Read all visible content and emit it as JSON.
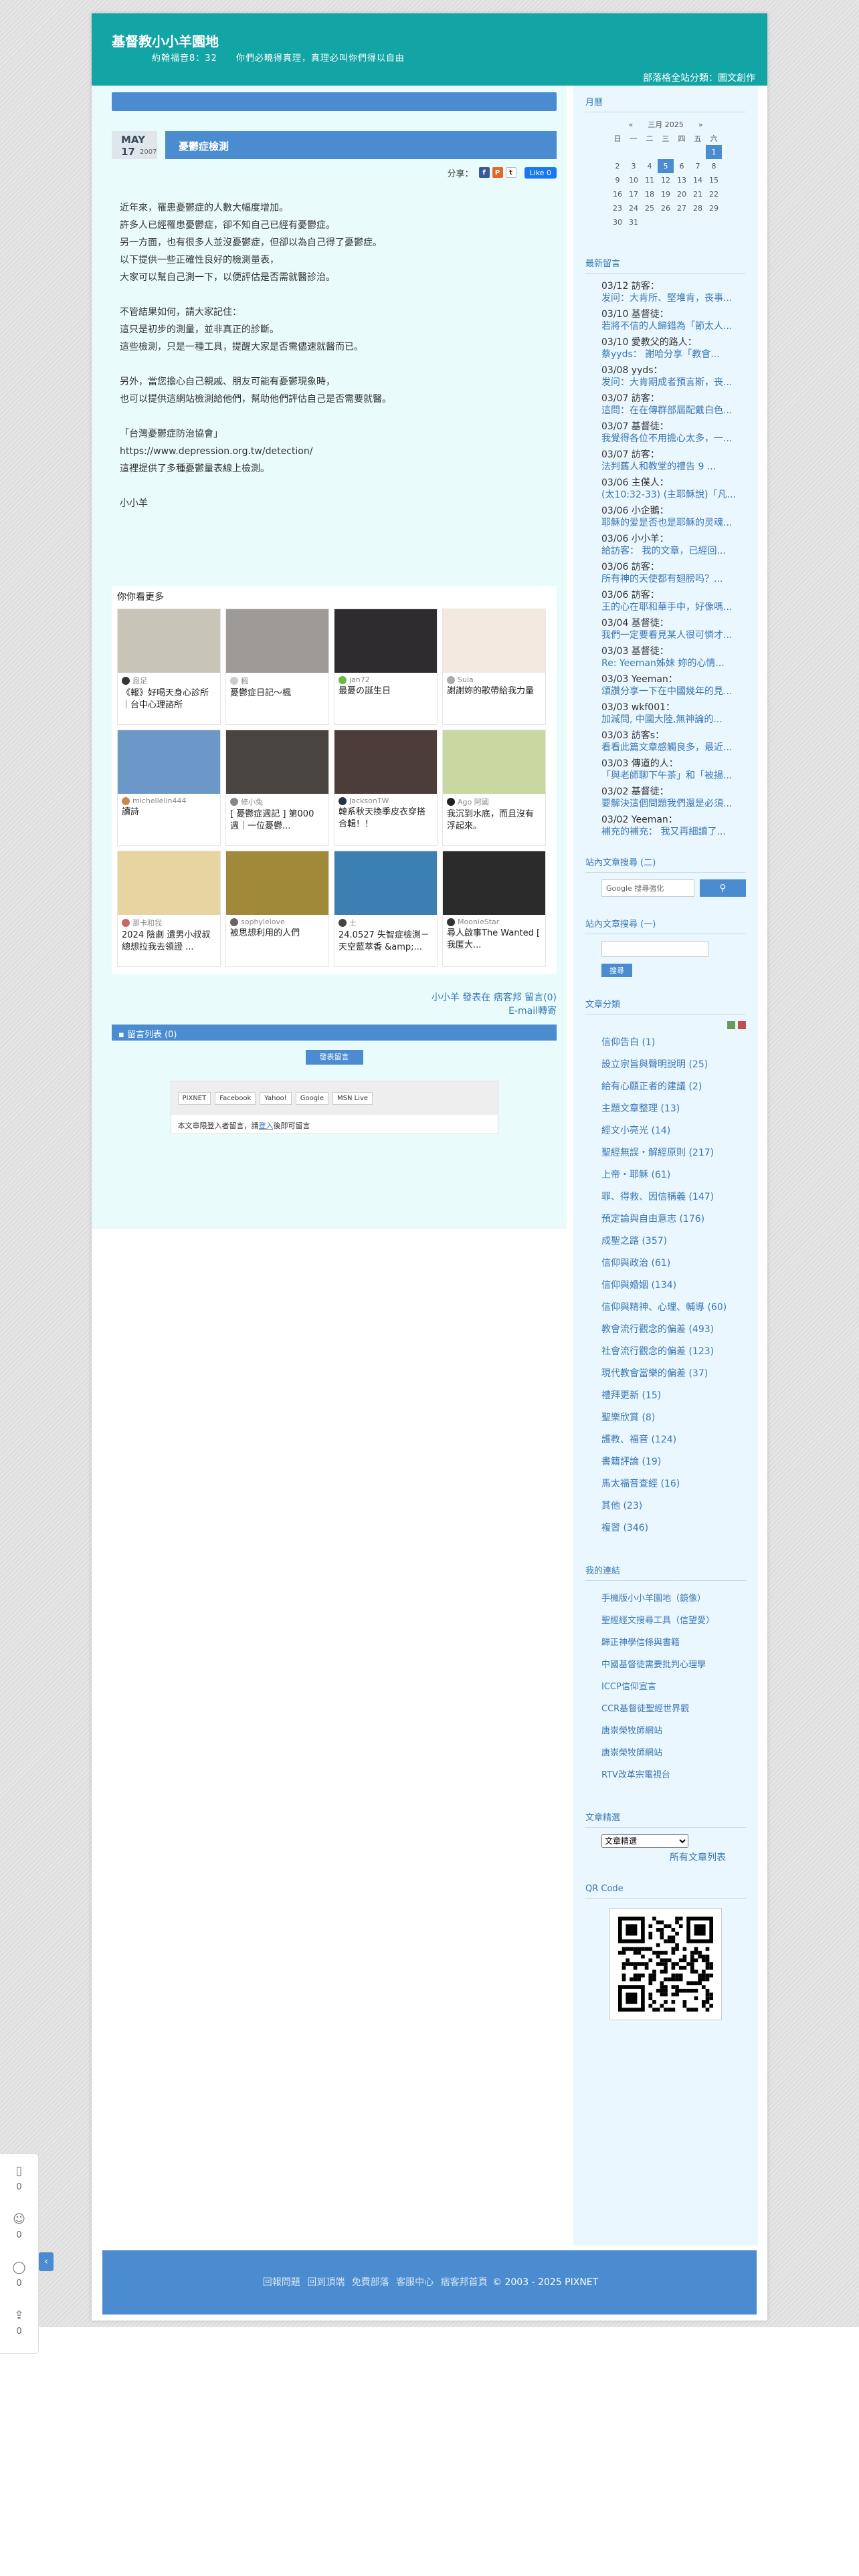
{
  "header": {
    "site_title": "基督教小小羊園地",
    "description": "約翰福音8：32　　你們必曉得真理，真理必叫你們得以自由",
    "partner_link": "部落格全站分類：圖文創作"
  },
  "post": {
    "month": "MAY",
    "day": "17",
    "year": "2007",
    "title": "憂鬱症檢測",
    "share_label": "分享：",
    "like_label": "Like 0",
    "paragraphs": [
      [
        "近年來，罹患憂鬱症的人數大幅度增加。",
        "許多人已經罹患憂鬱症，卻不知自己已經有憂鬱症。",
        "另一方面，也有很多人並沒憂鬱症，但卻以為自己得了憂鬱症。",
        "以下提供一些正確性良好的檢測量表，",
        "大家可以幫自己測一下，以便評估是否需就醫診治。"
      ],
      [
        "不管結果如何，請大家記住：",
        "這只是初步的測量，並非真正的診斷。",
        "這些檢測，只是一種工具，提醒大家是否需儘速就醫而已。"
      ],
      [
        "另外，當您擔心自己親戚、朋友可能有憂鬱現象時，",
        "也可以提供這網站檢測給他們，幫助他們評估自己是否需要就醫。"
      ],
      [
        "「台灣憂鬱症防治協會」",
        "https://www.depression.org.tw/detection/",
        "這裡提供了多種憂鬱量表線上檢測。"
      ],
      [
        "小小羊"
      ]
    ],
    "footer_line1": "小小羊 發表在 痞客邦 留言(0)",
    "footer_line2": "E-mail轉寄"
  },
  "more": {
    "title": "你你看更多",
    "cards": [
      {
        "author": "恩足",
        "title": "《報》好喝天身心診所｜台中心理諮所",
        "color": "#c9c4b8",
        "avatar": "#333"
      },
      {
        "author": "楓",
        "title": "憂鬱症日記～楓",
        "color": "#9e9a96",
        "avatar": "#ccc"
      },
      {
        "author": "jan72",
        "title": "最憂の誕生日",
        "color": "#2e2c2e",
        "avatar": "#6b4"
      },
      {
        "author": "Sula",
        "title": "謝謝妳的歌帶給我力量",
        "color": "#f3e9e1",
        "avatar": "#aaa"
      },
      {
        "author": "michellelin444",
        "title": "讀詩",
        "color": "#6b98c7",
        "avatar": "#c84"
      },
      {
        "author": "修小兔",
        "title": "[ 憂鬱症週記 ] 第000 週｜一位憂鬱...",
        "color": "#4a4440",
        "avatar": "#888"
      },
      {
        "author": "JacksonTW",
        "title": "韓系秋天換季皮衣穿搭合輯！！",
        "color": "#4c3d3a",
        "avatar": "#234"
      },
      {
        "author": "Ago 阿國",
        "title": "我沉到水底，而且沒有浮起來。",
        "color": "#c9d7a0",
        "avatar": "#222"
      },
      {
        "author": "那卡和我",
        "title": "2024 陰劇 遺男小叔叔總想拉我去領證 ...",
        "color": "#e6d5a0",
        "avatar": "#c66"
      },
      {
        "author": "sophylelove",
        "title": "被思想利用的人們",
        "color": "#a08a3a",
        "avatar": "#666"
      },
      {
        "author": "土",
        "title": "24.0527 失智症檢測－天空藍萃香 &amp;...",
        "color": "#3b7fb3",
        "avatar": "#444"
      },
      {
        "author": "MoonieStar",
        "title": "尋人啟事The Wanted [ 我匿大...",
        "color": "#2b2b2b",
        "avatar": "#333"
      }
    ]
  },
  "comments": {
    "bar_label": "留言列表 (0)",
    "post_button": "發表留言",
    "login_buttons": [
      "PIXNET",
      "Facebook",
      "Yahoo!",
      "Google",
      "MSN Live"
    ],
    "login_note_pre": "本文章限登入者留言，請",
    "login_note_link": "登入",
    "login_note_post": "後即可留言"
  },
  "sidebar": {
    "month_title": "月曆",
    "calendar": {
      "header": "«　　三月 2025　　»",
      "weekdays": [
        "日",
        "一",
        "二",
        "三",
        "四",
        "五",
        "六"
      ],
      "rows": [
        [
          "",
          "",
          "",
          "",
          "",
          "",
          "1"
        ],
        [
          "2",
          "3",
          "4",
          "5",
          "6",
          "7",
          "8"
        ],
        [
          "9",
          "10",
          "11",
          "12",
          "13",
          "14",
          "15"
        ],
        [
          "16",
          "17",
          "18",
          "19",
          "20",
          "21",
          "22"
        ],
        [
          "23",
          "24",
          "25",
          "26",
          "27",
          "28",
          "29"
        ],
        [
          "30",
          "31",
          "",
          "",
          "",
          "",
          ""
        ]
      ]
    },
    "recent_title": "最新留言",
    "recent_messages": [
      {
        "head": "03/12 訪客：",
        "body": "发问：大肯所、堅堆肯，丧事..."
      },
      {
        "head": "03/10 基督徒：",
        "body": "若將不信的人歸錯為「節太人..."
      },
      {
        "head": "03/10 愛教父的路人：",
        "body": "蔡yyds： 謝哈分享「教會..."
      },
      {
        "head": "03/08 yyds：",
        "body": "发问：大肯期成者預言斯，丧..."
      },
      {
        "head": "03/07 訪客：",
        "body": "這問：在在傳群部屆配戴白色..."
      },
      {
        "head": "03/07 基督徒：",
        "body": "我覺得各位不用擔心太多，一..."
      },
      {
        "head": "03/07 訪客：",
        "body": "法判舊人和教堂的禮告 9 ..."
      },
      {
        "head": "03/06 主僕人：",
        "body": "(太10:32-33) (主耶穌說)「凡..."
      },
      {
        "head": "03/06 小企鵝：",
        "body": "耶穌的爱是否也是耶穌的灵魂..."
      },
      {
        "head": "03/06 小小羊：",
        "body": "給訪客： 我的文章，已經回..."
      },
      {
        "head": "03/06 訪客：",
        "body": "所有神的天使都有翅膀吗？..."
      },
      {
        "head": "03/06 訪客：",
        "body": "王的心在耶和華手中，好像嗎..."
      },
      {
        "head": "03/04 基督徒：",
        "body": "我們一定要看見某人很可憐才..."
      },
      {
        "head": "03/03 基督徒：",
        "body": "Re: Yeeman姊妹 妳的心情..."
      },
      {
        "head": "03/03 Yeeman：",
        "body": "頌讚分享一下在中國幾年的見..."
      },
      {
        "head": "03/03 wkf001：",
        "body": "加減問, 中國大陸,無神論的..."
      },
      {
        "head": "03/03 訪客s：",
        "body": "看看此篇文章感觸良多，最近..."
      },
      {
        "head": "03/03 傳道的人：",
        "body": "「與老師聊下午茶」和「被揚..."
      },
      {
        "head": "03/02 基督徒：",
        "body": "要解決這個問題我們還是必須..."
      },
      {
        "head": "03/02 Yeeman：",
        "body": "補充的補充： 我又再細讀了..."
      }
    ],
    "google_title": "站內文章搜尋 (二)",
    "google_placeholder": "Google 搜尋強化",
    "site_search_title": "站內文章搜尋 (一)",
    "site_search_button": "搜尋",
    "category_title": "文章分類",
    "categories": [
      "信仰告白 (1)",
      "設立宗旨與聲明說明 (25)",
      "給有心願正者的建議 (2)",
      "主題文章整理 (13)",
      "經文小亮光 (14)",
      "聖經無誤・解經原則 (217)",
      "上帝・耶穌 (61)",
      "罪、得救、因信稱義 (147)",
      "預定論與自由意志 (176)",
      "成聖之路 (357)",
      "信仰與政治 (61)",
      "信仰與婚姻 (134)",
      "信仰與精神、心理、輔導 (60)",
      "教會流行觀念的偏差 (493)",
      "社會流行觀念的偏差 (123)",
      "現代教會當樂的偏差 (37)",
      "禮拜更新 (15)",
      "聖樂欣賞 (8)",
      "護教、福音 (124)",
      "書籍評論 (19)",
      "馬太福音查經 (16)",
      "其他 (23)",
      "複習 (346)"
    ],
    "links_title": "我的連結",
    "links": [
      "手機版小小羊園地（鏡像）",
      "聖經經文搜尋工具（信望愛）",
      "歸正神學信條與書籍",
      "中國基督徒需要批判心理學",
      "ICCP信仰宣言",
      "CCR基督徒聖經世界觀",
      "唐崇榮牧師網站",
      "唐崇榮牧師網站",
      "RTV改革宗電視台"
    ],
    "archive_title": "文章精選",
    "archive_select": "文章精選",
    "archive_link": "所有文章列表",
    "qr_title": "QR Code"
  },
  "footer": {
    "links": [
      "回報問題",
      "回到頂端",
      "免費部落",
      "客服中心",
      "痞客邦首頁"
    ],
    "copyright": "© 2003 - 2025 PIXNET"
  },
  "float_panel": {
    "counts": [
      "0",
      "0",
      "0",
      "0"
    ]
  }
}
